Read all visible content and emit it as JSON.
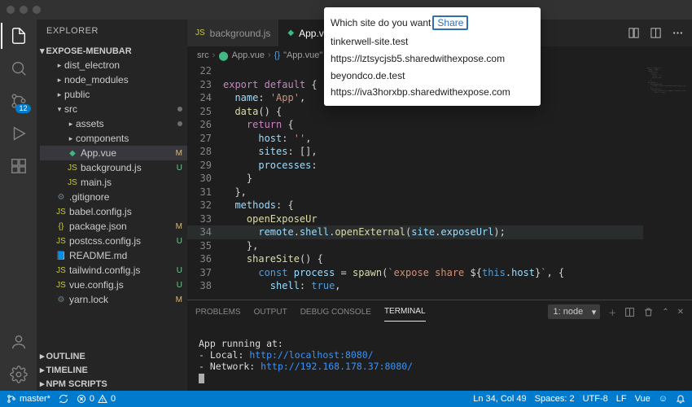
{
  "titlebar": {
    "title": ""
  },
  "activity": {
    "scm_badge": "12"
  },
  "explorer": {
    "title": "EXPLORER",
    "root": "EXPOSE-MENUBAR",
    "tree": [
      {
        "label": "dist_electron",
        "type": "folder"
      },
      {
        "label": "node_modules",
        "type": "folder"
      },
      {
        "label": "public",
        "type": "folder"
      },
      {
        "label": "src",
        "type": "folder",
        "open": true,
        "dot": true
      },
      {
        "label": "assets",
        "type": "folder",
        "indent": 2,
        "dot": true
      },
      {
        "label": "components",
        "type": "folder",
        "indent": 2
      },
      {
        "label": "App.vue",
        "type": "vue",
        "indent": 2,
        "status": "M",
        "selected": true
      },
      {
        "label": "background.js",
        "type": "js",
        "indent": 2,
        "status": "U"
      },
      {
        "label": "main.js",
        "type": "js",
        "indent": 2
      },
      {
        "label": ".gitignore",
        "type": "conf",
        "indent": 1
      },
      {
        "label": "babel.config.js",
        "type": "js",
        "indent": 1
      },
      {
        "label": "package.json",
        "type": "json",
        "indent": 1,
        "status": "M"
      },
      {
        "label": "postcss.config.js",
        "type": "js",
        "indent": 1,
        "status": "U"
      },
      {
        "label": "README.md",
        "type": "md",
        "indent": 1
      },
      {
        "label": "tailwind.config.js",
        "type": "js",
        "indent": 1,
        "status": "U"
      },
      {
        "label": "vue.config.js",
        "type": "js",
        "indent": 1,
        "status": "U"
      },
      {
        "label": "yarn.lock",
        "type": "conf",
        "indent": 1,
        "status": "M"
      }
    ],
    "outline": "OUTLINE",
    "timeline": "TIMELINE",
    "npm": "NPM SCRIPTS"
  },
  "tabs": [
    {
      "label": "background.js",
      "icon": "js"
    },
    {
      "label": "App.vue",
      "icon": "vue",
      "active": true
    }
  ],
  "breadcrumb": {
    "p1": "src",
    "p2": "App.vue",
    "p3": "\"App.vue\""
  },
  "code": {
    "start": 22,
    "lines": [
      "",
      "<kw>export</kw> <kw>default</kw> <pun>{</pun>",
      "  <var>name</var><pun>:</pun> <str>'App'</str><pun>,</pun>",
      "  <fn>data</fn><pun>() {</pun>",
      "    <kw>return</kw> <pun>{</pun>",
      "      <var>host</var><pun>:</pun> <str>''</str><pun>,</pun>",
      "      <var>sites</var><pun>: [],</pun>",
      "      <var>processes</var><pun>:</pun>",
      "    <pun>}</pun>",
      "  <pun>},</pun>",
      "  <var>methods</var><pun>: {</pun>",
      "    <fn>openExposeUr</fn>",
      "      <var>remote</var><pun>.</pun><var>shell</var><pun>.</pun><fn>openExternal</fn><pun>(</pun><var>site</var><pun>.</pun><var>exposeUrl</var><pun>);</pun>",
      "    <pun>},</pun>",
      "    <fn>shareSite</fn><pun>() {</pun>",
      "      <sk>const</sk> <var>process</var> <pun>=</pun> <fn>spawn</fn><pun>(</pun><str>`expose share </str><pun>${</pun><sk>this</sk><pun>.</pun><var>host</var><pun>}</pun><str>`</str><pun>, {</pun>",
      "        <var>shell</var><pun>:</pun> <sk>true</sk><pun>,</pun>"
    ],
    "highlight": 34
  },
  "popup": {
    "prompt": "Which site do you want",
    "share_label": "Share",
    "items": [
      "tinkerwell-site.test",
      "https://lztsycjsb5.sharedwithexpose.com",
      "beyondco.de.test",
      "https://iva3horxbp.sharedwithexpose.com"
    ]
  },
  "panel": {
    "tabs": {
      "problems": "PROBLEMS",
      "output": "OUTPUT",
      "debug": "DEBUG CONSOLE",
      "terminal": "TERMINAL"
    },
    "term_select": "1: node",
    "term_lines": [
      {
        "text": "App running at:"
      },
      {
        "text": "- Local:   ",
        "url": "http://localhost:8080/"
      },
      {
        "text": "- Network: ",
        "url": "http://192.168.178.37:8080/"
      }
    ]
  },
  "status": {
    "branch": "master*",
    "sync": "",
    "errors": "0",
    "warnings": "0",
    "pos": "Ln 34, Col 49",
    "spaces": "Spaces: 2",
    "enc": "UTF-8",
    "eol": "LF",
    "lang": "Vue"
  }
}
